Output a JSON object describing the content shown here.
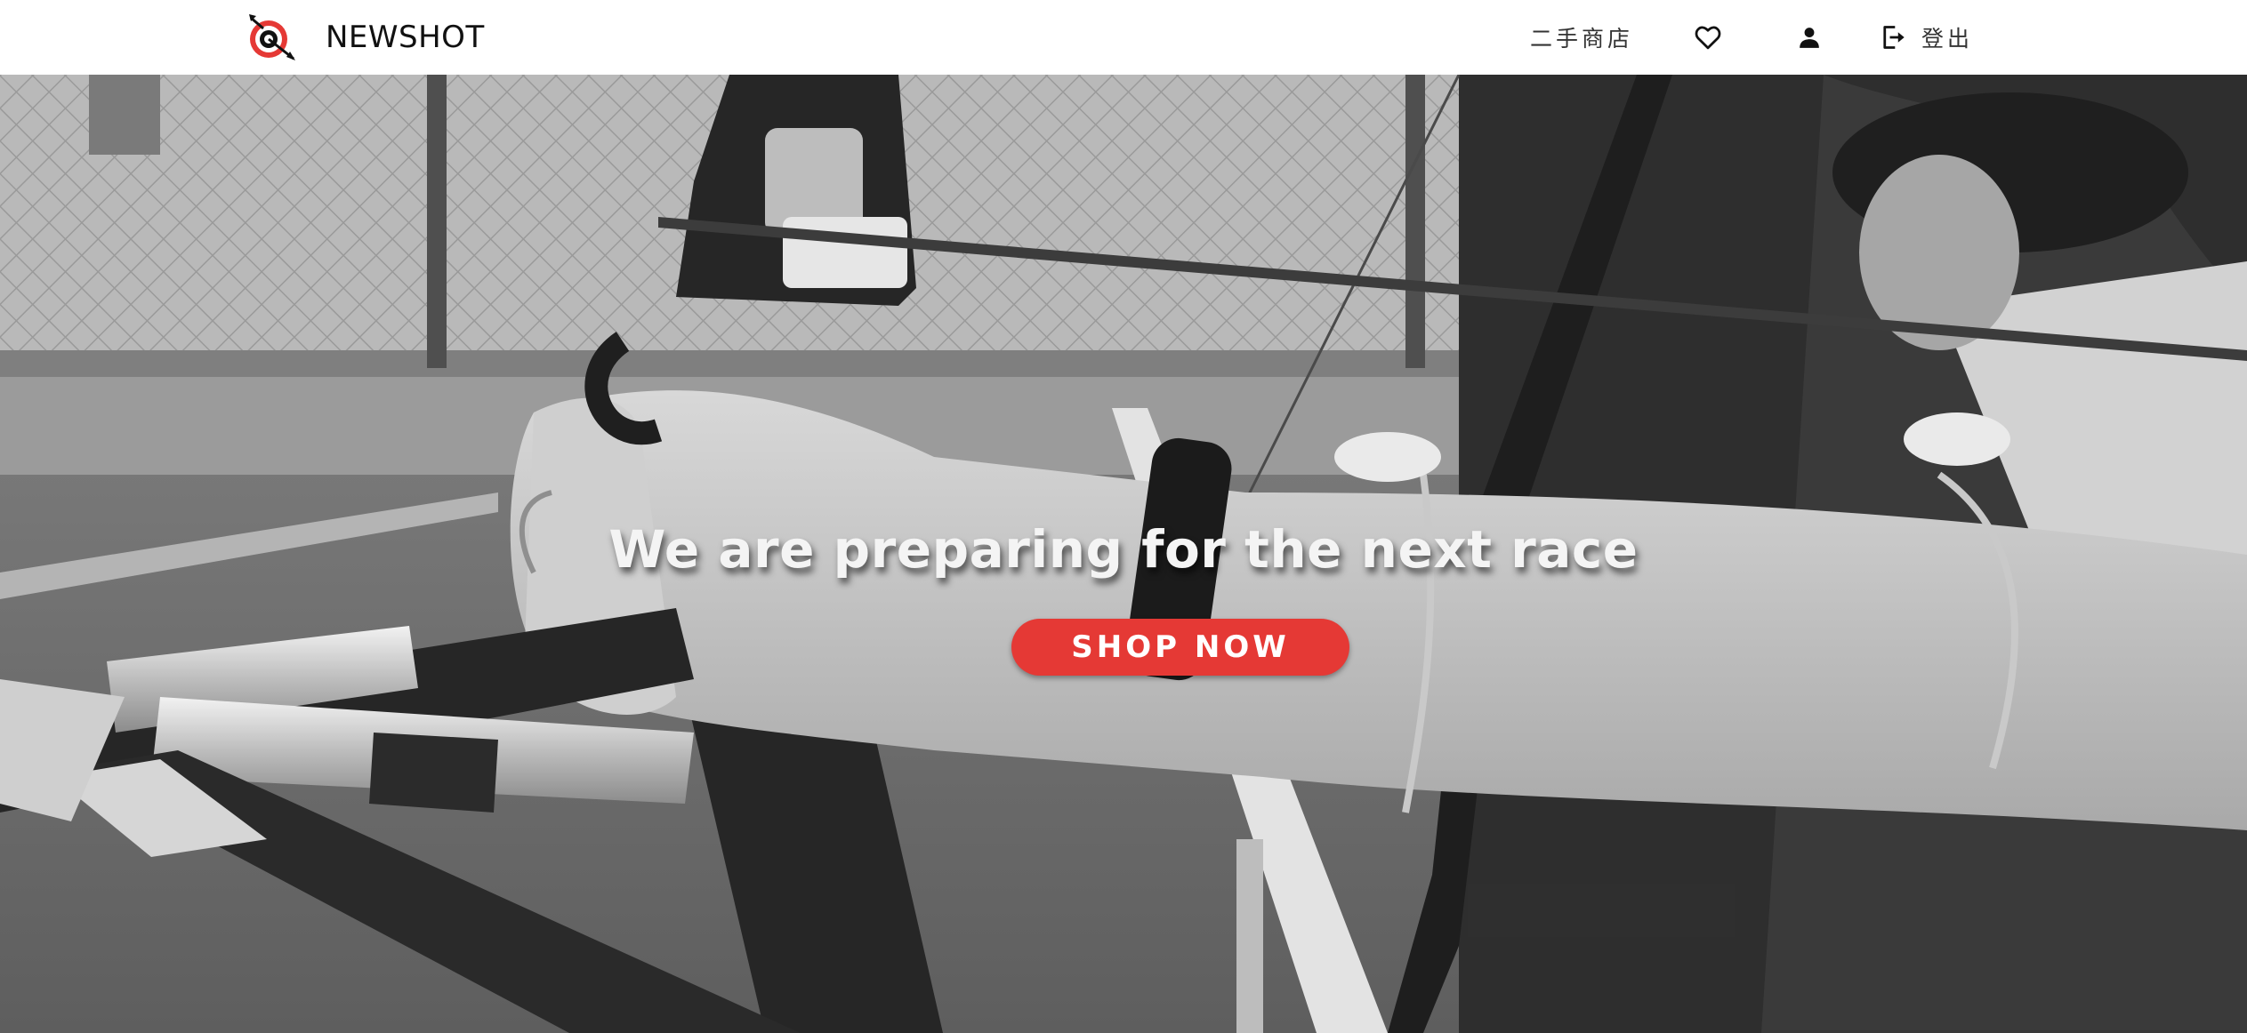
{
  "header": {
    "brand": "NEWSHOT",
    "nav_links": {
      "secondhand_shop": "二手商店",
      "logout": "登出"
    },
    "icons": {
      "logo": "target-arrow-icon",
      "favorites": "heart-icon",
      "account": "person-icon",
      "logout": "logout-icon"
    }
  },
  "hero": {
    "title": "We are preparing for the next race",
    "cta_label": "SHOP NOW",
    "background": "grayscale archery photo"
  },
  "colors": {
    "accent": "#e53935",
    "logo_red": "#e53935",
    "nav_text": "#333333",
    "header_bg": "#ffffff"
  }
}
